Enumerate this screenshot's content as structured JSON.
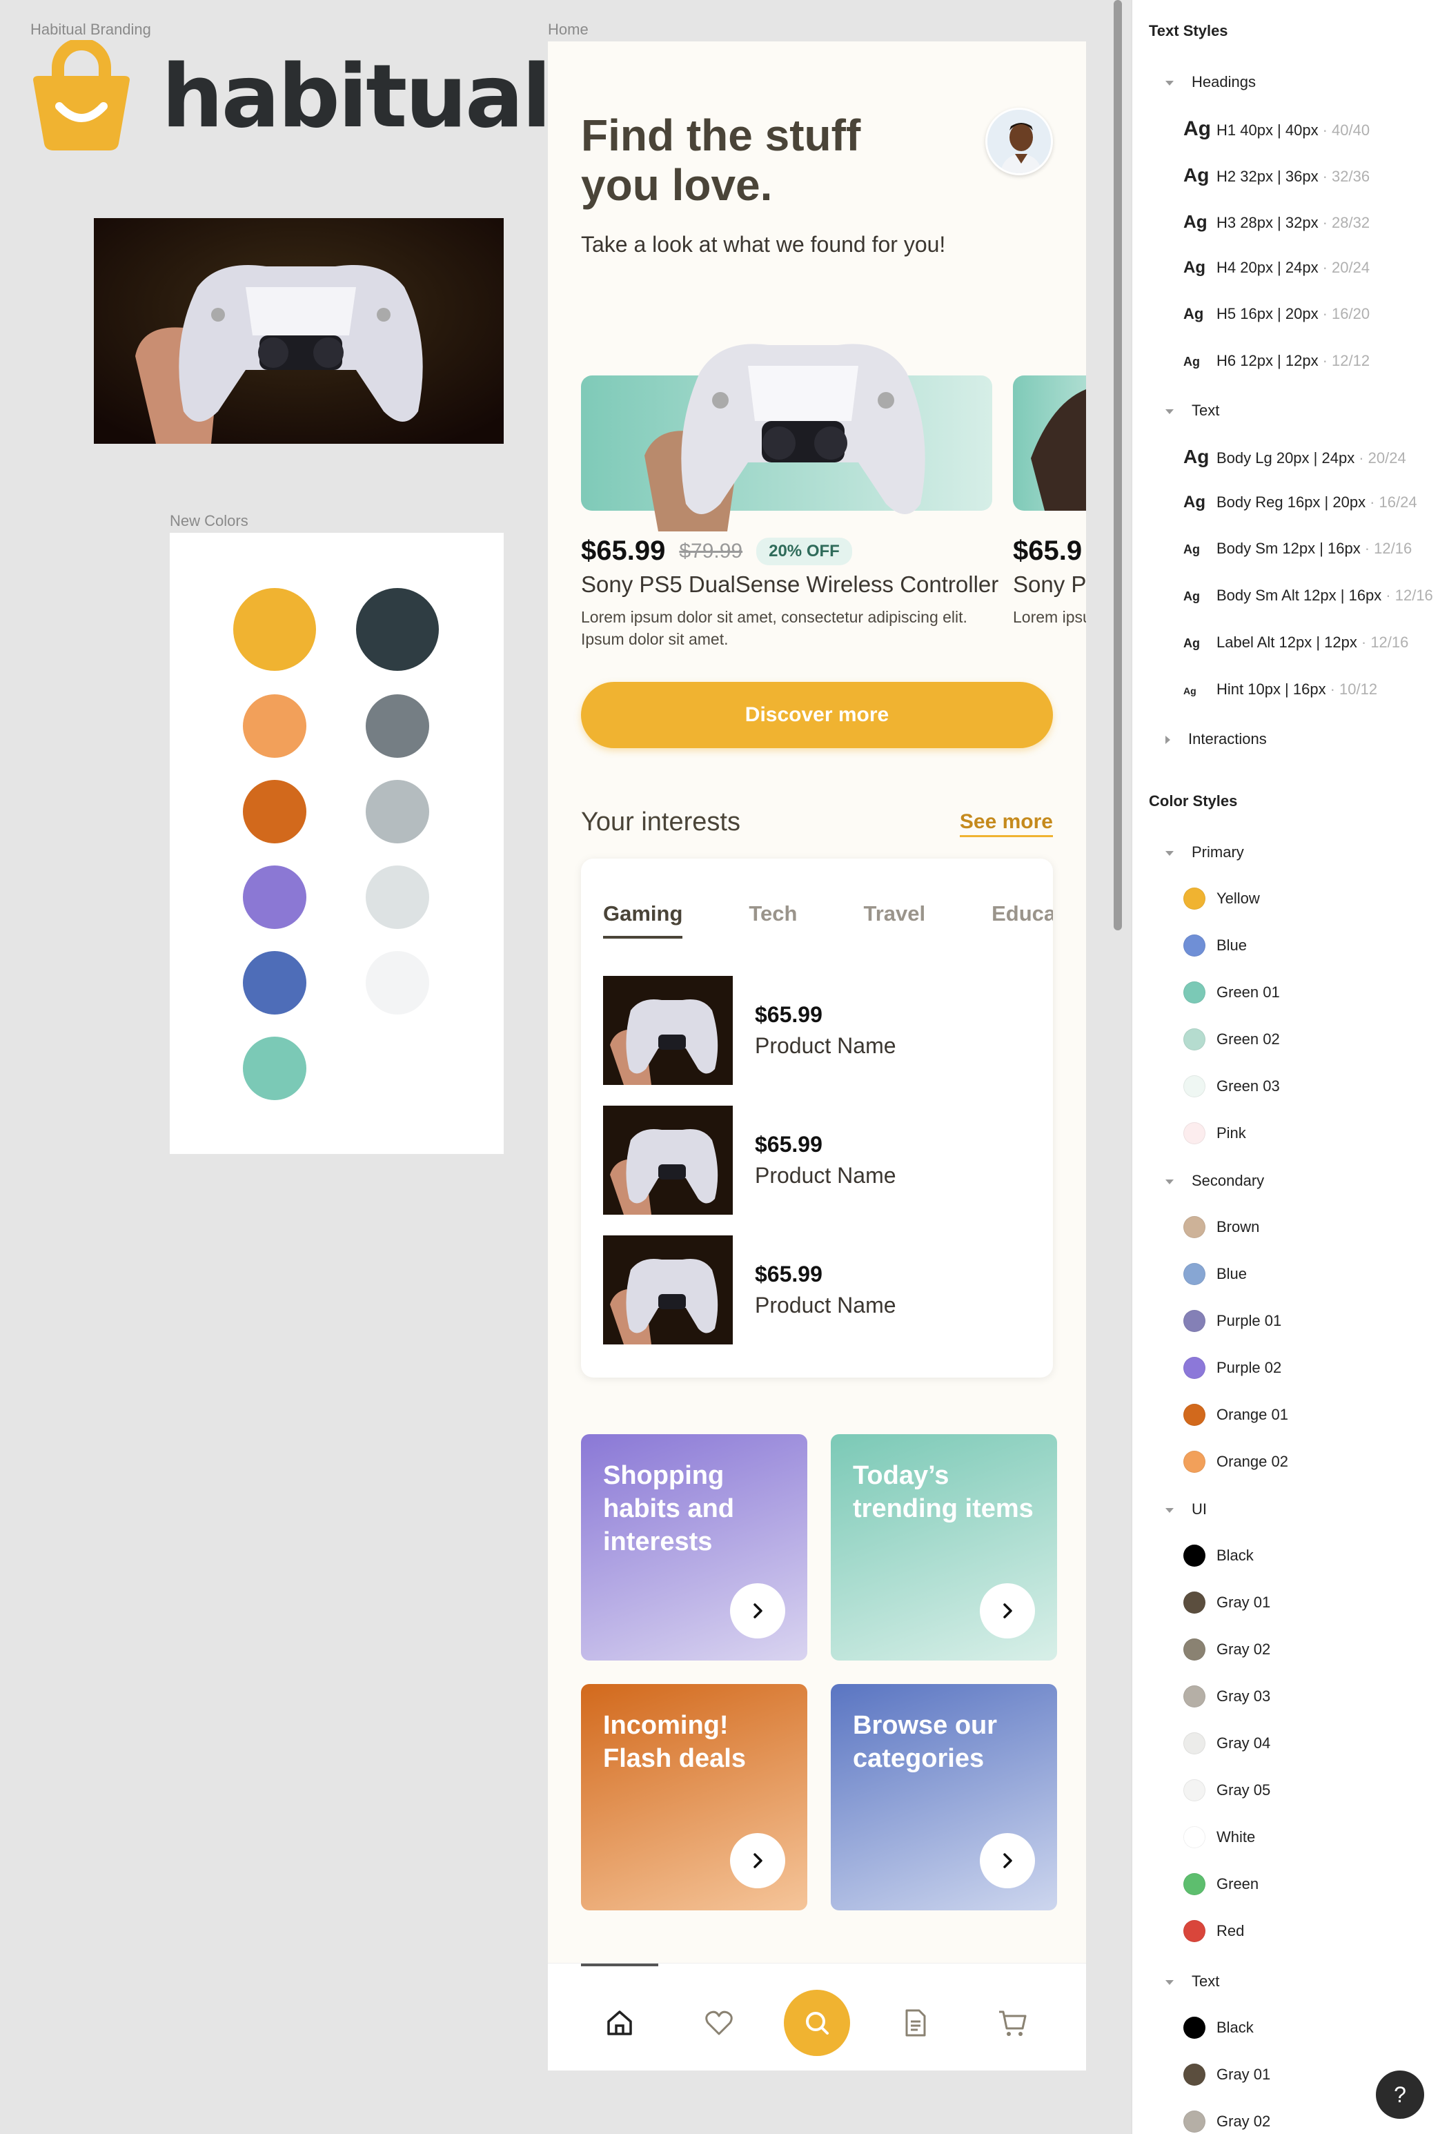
{
  "branding": {
    "frame_label": "Habitual Branding",
    "logo_text": "habitual"
  },
  "colors_board": {
    "frame_label": "New Colors",
    "swatches": [
      "#F0B331",
      "#2F3D43",
      "#F2A05A",
      "#757E84",
      "#D2691C",
      "#B4BCBF",
      "#8B78D4",
      "#DDE2E3",
      "#4E6DB8",
      "#F3F4F5",
      "#7BC9B6"
    ]
  },
  "home": {
    "frame_label": "Home",
    "headline_line1": "Find the stuff",
    "headline_line2": "you love.",
    "subtitle": "Take a look at what we found for you!",
    "featured": {
      "price": "$65.99",
      "old_price": "$79.99",
      "badge": "20% OFF",
      "title": "Sony PS5 DualSense Wireless Controller",
      "description": "Lorem ipsum dolor sit amet, consectetur adipiscing elit. Ipsum dolor sit amet."
    },
    "peek": {
      "price": "$65.9",
      "title": "Sony PS",
      "description": "Lorem ipsu Ipsum dolo"
    },
    "discover_label": "Discover more",
    "interests_title": "Your interests",
    "see_more": "See more",
    "tabs": [
      "Gaming",
      "Tech",
      "Travel",
      "Educat"
    ],
    "items": [
      {
        "price": "$65.99",
        "name": "Product Name"
      },
      {
        "price": "$65.99",
        "name": "Product Name"
      },
      {
        "price": "$65.99",
        "name": "Product Name"
      }
    ],
    "tiles": [
      {
        "title": "Shopping habits and interests"
      },
      {
        "title": "Today’s trending items"
      },
      {
        "title": "Incoming! Flash deals"
      },
      {
        "title": "Browse our categories"
      }
    ],
    "nav_icons": [
      "home-icon",
      "heart-icon",
      "search-icon",
      "document-icon",
      "cart-icon"
    ],
    "accent": "#F0B331"
  },
  "panel": {
    "text_styles_title": "Text Styles",
    "headings_group": "Headings",
    "headings": [
      {
        "ag": "Ag",
        "name": "H1 40px | 40px",
        "meta": "· 40/40"
      },
      {
        "ag": "Ag",
        "name": "H2 32px | 36px",
        "meta": "· 32/36"
      },
      {
        "ag": "Ag",
        "name": "H3 28px | 32px",
        "meta": "· 28/32"
      },
      {
        "ag": "Ag",
        "name": "H4 20px | 24px",
        "meta": "· 20/24"
      },
      {
        "ag": "Ag",
        "name": "H5 16px | 20px",
        "meta": "· 16/20"
      },
      {
        "ag": "Ag",
        "name": "H6 12px | 12px",
        "meta": "· 12/12"
      }
    ],
    "text_group": "Text",
    "text_styles": [
      {
        "ag": "Ag",
        "name": "Body Lg 20px | 24px",
        "meta": "· 20/24"
      },
      {
        "ag": "Ag",
        "name": "Body Reg 16px | 20px",
        "meta": "· 16/24"
      },
      {
        "ag": "Ag",
        "name": "Body Sm 12px | 16px",
        "meta": "· 12/16"
      },
      {
        "ag": "Ag",
        "name": "Body Sm Alt 12px | 16px",
        "meta": "· 12/16"
      },
      {
        "ag": "Ag",
        "name": "Label Alt 12px | 12px",
        "meta": "· 12/16"
      },
      {
        "ag": "Ag",
        "name": "Hint 10px | 16px",
        "meta": "· 10/12"
      }
    ],
    "interactions_group": "Interactions",
    "color_styles_title": "Color Styles",
    "primary_group": "Primary",
    "primary": [
      {
        "name": "Yellow",
        "color": "#F0B331"
      },
      {
        "name": "Blue",
        "color": "#6F8FD6"
      },
      {
        "name": "Green 01",
        "color": "#7BC9B6"
      },
      {
        "name": "Green 02",
        "color": "#B5DCCF"
      },
      {
        "name": "Green 03",
        "color": "#EFF7F3"
      },
      {
        "name": "Pink",
        "color": "#FCEDEE"
      }
    ],
    "secondary_group": "Secondary",
    "secondary": [
      {
        "name": "Brown",
        "color": "#CDB298"
      },
      {
        "name": "Blue",
        "color": "#87A6D3"
      },
      {
        "name": "Purple 01",
        "color": "#8480B6"
      },
      {
        "name": "Purple 02",
        "color": "#8C78D9"
      },
      {
        "name": "Orange 01",
        "color": "#D2691C"
      },
      {
        "name": "Orange 02",
        "color": "#F2A05A"
      }
    ],
    "ui_group": "UI",
    "ui": [
      {
        "name": "Black",
        "color": "#000000"
      },
      {
        "name": "Gray 01",
        "color": "#5B4E3E"
      },
      {
        "name": "Gray 02",
        "color": "#8A8272"
      },
      {
        "name": "Gray 03",
        "color": "#B5AFA6"
      },
      {
        "name": "Gray 04",
        "color": "#ECECEA"
      },
      {
        "name": "Gray 05",
        "color": "#F4F4F3"
      },
      {
        "name": "White",
        "color": "#FFFFFF"
      },
      {
        "name": "Green",
        "color": "#5DBE6E"
      },
      {
        "name": "Red",
        "color": "#D9463B"
      }
    ],
    "text_colors_group": "Text",
    "text_colors": [
      {
        "name": "Black",
        "color": "#000000"
      },
      {
        "name": "Gray 01",
        "color": "#5B4E3E"
      },
      {
        "name": "Gray 02",
        "color": "#B5AFA6"
      }
    ],
    "help_label": "?"
  }
}
